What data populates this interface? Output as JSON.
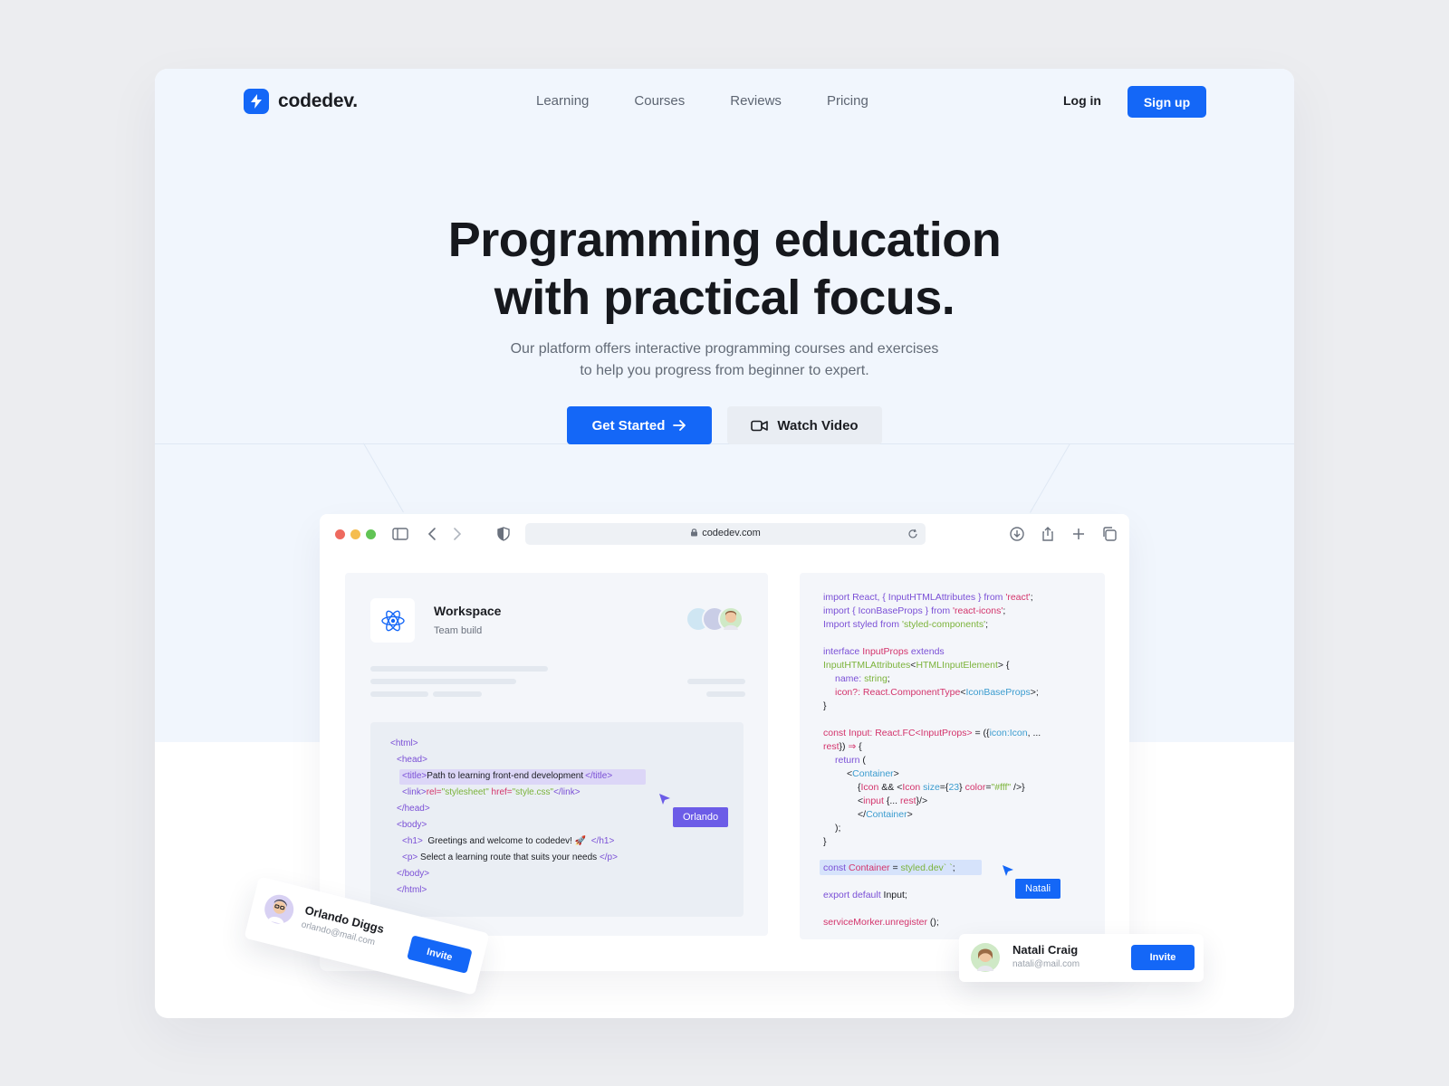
{
  "brand": {
    "name": "codedev.",
    "accent": "#1467f7"
  },
  "nav": {
    "links": [
      "Learning",
      "Courses",
      "Reviews",
      "Pricing"
    ],
    "login_label": "Log in",
    "signup_label": "Sign up"
  },
  "hero": {
    "headline_line1": "Programming education",
    "headline_line2": "with practical focus.",
    "sub_line1": "Our platform offers interactive programming courses and exercises",
    "sub_line2": "to help you progress from beginner to expert.",
    "primary_cta": "Get Started",
    "secondary_cta": "Watch Video",
    "primary_icon": "arrow-right-icon",
    "secondary_icon": "video-camera-icon"
  },
  "browser": {
    "url": "codedev.com",
    "traffic_light_colors": [
      "#ee6a5f",
      "#f5bd4f",
      "#61c454"
    ]
  },
  "workspace": {
    "title": "Workspace",
    "subtitle": "Team build",
    "icon": "react-icon"
  },
  "html_snippet": {
    "lines": [
      "<html>",
      "<head>",
      "<title>",
      "Path to learning front-end development",
      "</title>",
      "<link>",
      "rel=",
      "\"stylesheet\"",
      "href=",
      "\"style.css\"",
      "</link>",
      "</head>",
      "<body>",
      "<h1>",
      "Greetings and welcome to codedev! 🚀",
      "</h1>",
      "<p>",
      "Select a learning route that suits your needs",
      "</p>",
      "</body>",
      "</html>"
    ],
    "cursor_label": "Orlando",
    "cursor_color": "#6c5ce7"
  },
  "code_snippet": {
    "l1a": "import React, { InputHTMLAttributes } from ",
    "l1b": "'react'",
    "l1c": ";",
    "l2a": "import { IconBaseProps } from ",
    "l2b": "'react-icons'",
    "l2c": ";",
    "l3a": "Import styled from ",
    "l3b": "'styled-components'",
    "l3c": ";",
    "l4a": "interface ",
    "l4b": "InputProps ",
    "l4c": "extends",
    "l5a": "InputHTMLAttributes",
    "l5b": "<",
    "l5c": "HTMLInputElement",
    "l5d": "> {",
    "l6a": "name: ",
    "l6b": "string",
    "l6c": ";",
    "l7a": "icon?: React.ComponentType",
    "l7b": "<",
    "l7c": "IconBaseProps",
    "l7d": ">;",
    "l8": "}",
    "l9a": "const Input: React.FC",
    "l9b": "<InputProps>",
    "l9c": " = ({",
    "l9d": "icon:Icon",
    "l9e": ", ...",
    "l10a": "rest",
    "l10b": "}) ",
    "l10c": "⇒",
    "l10d": " {",
    "l11a": "return ",
    "l11b": "(",
    "l12a": "<",
    "l12b": "Container",
    "l12c": ">",
    "l13a": "{",
    "l13b": "Icon ",
    "l13c": "&& <",
    "l13d": "Icon ",
    "l13e": "size",
    "l13f": "={",
    "l13g": "23",
    "l13h": "} ",
    "l13i": "color",
    "l13j": "=",
    "l13k": "\"#fff\"",
    "l13l": " />}",
    "l14a": "<",
    "l14b": "input ",
    "l14c": "{... ",
    "l14d": "rest",
    "l14e": "}/>",
    "l15a": "</",
    "l15b": "Container",
    "l15c": ">",
    "l16": ");",
    "l17": "}",
    "l18a": "const ",
    "l18b": "Container",
    "l18c": " = ",
    "l18d": "styled.dev` `",
    "l18e": ";",
    "l19a": "export default ",
    "l19b": "Input;",
    "l20a": "serviceMorker.unregister ",
    "l20b": "();",
    "cursor_label": "Natali",
    "cursor_color": "#1467f7"
  },
  "invites": [
    {
      "name": "Orlando Diggs",
      "email": "orlando@mail.com",
      "button": "Invite"
    },
    {
      "name": "Natali Craig",
      "email": "natali@mail.com",
      "button": "Invite"
    }
  ]
}
